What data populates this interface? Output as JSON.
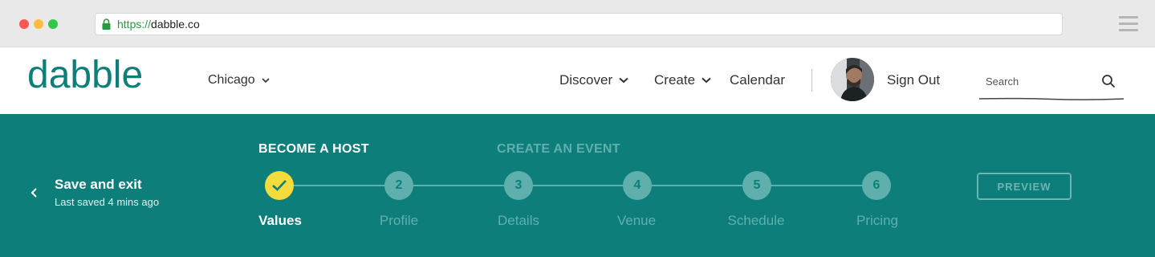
{
  "browser": {
    "url_scheme": "https://",
    "url_host": "dabble.co"
  },
  "site": {
    "logo_text": "dabble",
    "city": "Chicago",
    "nav": {
      "discover": "Discover",
      "create": "Create",
      "calendar": "Calendar",
      "sign_out": "Sign Out"
    },
    "search": {
      "placeholder": "Search"
    }
  },
  "wizard": {
    "save_title": "Save and exit",
    "save_sub": "Last saved 4 mins ago",
    "phases": {
      "host": "BECOME A HOST",
      "event": "CREATE AN EVENT"
    },
    "steps": [
      {
        "number": "1",
        "label": "Values",
        "status": "completed"
      },
      {
        "number": "2",
        "label": "Profile",
        "status": "upcoming"
      },
      {
        "number": "3",
        "label": "Details",
        "status": "upcoming"
      },
      {
        "number": "4",
        "label": "Venue",
        "status": "upcoming"
      },
      {
        "number": "5",
        "label": "Schedule",
        "status": "upcoming"
      },
      {
        "number": "6",
        "label": "Pricing",
        "status": "upcoming"
      }
    ],
    "preview_label": "PREVIEW"
  },
  "colors": {
    "brand_teal": "#0e7e7b",
    "step_done_yellow": "#f5db3c",
    "step_upcoming": "#5fb0ad",
    "url_scheme_green": "#2a9a41"
  },
  "icons": [
    "lock-icon",
    "hamburger-icon",
    "chevron-down-icon",
    "search-icon",
    "chevron-left-icon",
    "check-icon"
  ]
}
